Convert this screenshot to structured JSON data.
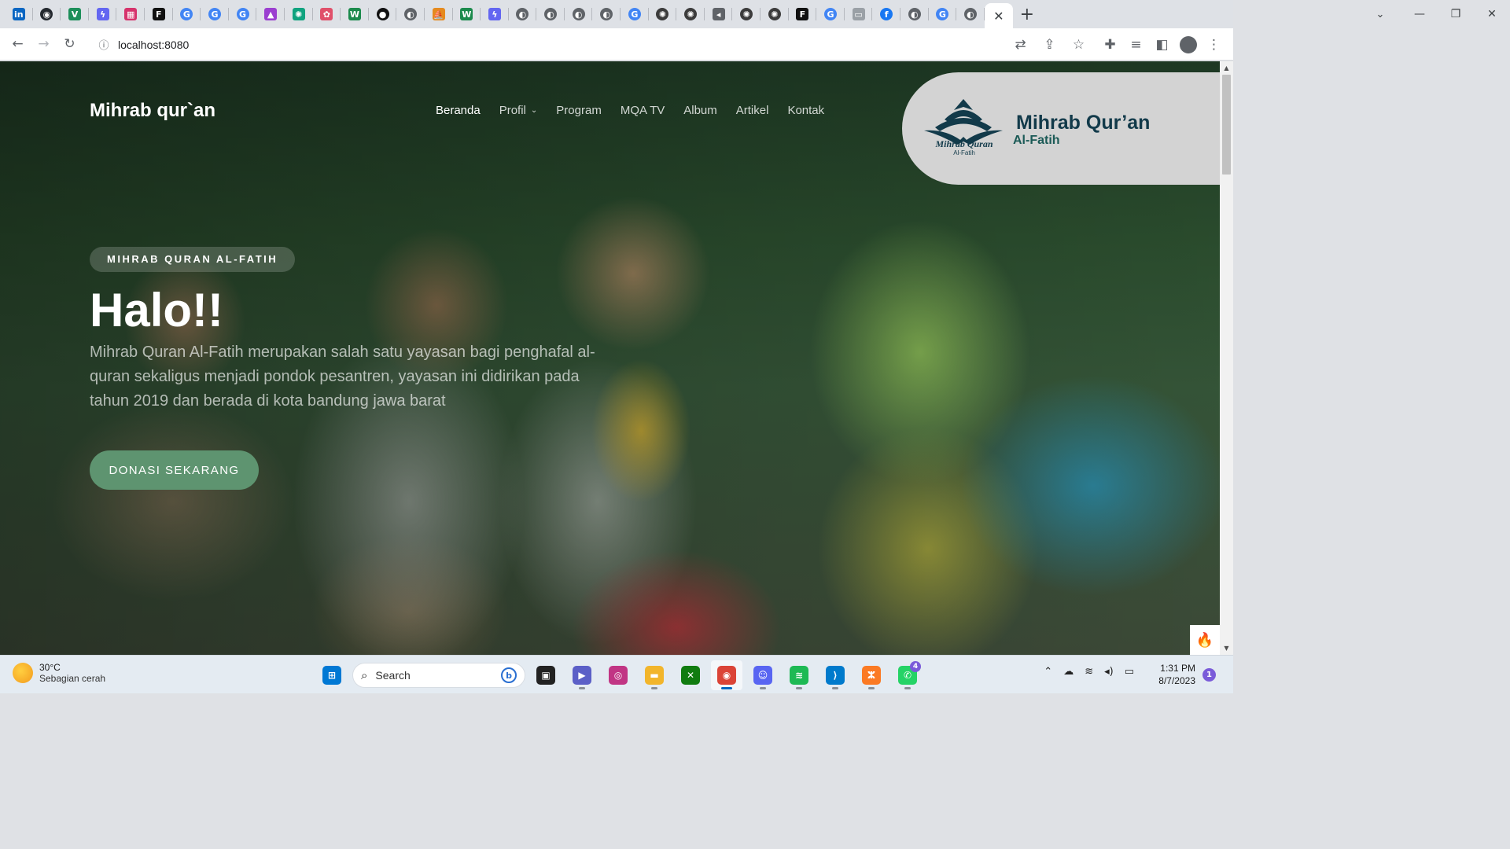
{
  "browser": {
    "tab_favicons": [
      {
        "name": "linkedin-icon",
        "glyph": "in",
        "color": "#0a66c2"
      },
      {
        "name": "github-icon",
        "glyph": "◉",
        "color": "#24292f",
        "circle": true
      },
      {
        "name": "vuejs-icon",
        "glyph": "V",
        "color": "#1d8f5a"
      },
      {
        "name": "stripe-bolt-icon",
        "glyph": "ϟ",
        "color": "#6366f1"
      },
      {
        "name": "grid-app-icon",
        "glyph": "▦",
        "color": "#d6336c"
      },
      {
        "name": "f-app-icon",
        "glyph": "F",
        "color": "#111111"
      },
      {
        "name": "google-icon",
        "glyph": "G",
        "color": "#4285f4",
        "circle": true
      },
      {
        "name": "google-icon",
        "glyph": "G",
        "color": "#4285f4",
        "circle": true
      },
      {
        "name": "google-icon",
        "glyph": "G",
        "color": "#4285f4",
        "circle": true
      },
      {
        "name": "triangle-app-icon",
        "glyph": "▲",
        "color": "#9b3fd0"
      },
      {
        "name": "chatgpt-icon",
        "glyph": "✺",
        "color": "#10a37f"
      },
      {
        "name": "brain-app-icon",
        "glyph": "✿",
        "color": "#e0506a"
      },
      {
        "name": "w-app-icon",
        "glyph": "W",
        "color": "#1b8a4c"
      },
      {
        "name": "record-app-icon",
        "glyph": "●",
        "color": "#111111",
        "circle": true
      },
      {
        "name": "globe-icon",
        "glyph": "◐",
        "color": "#5f6368",
        "circle": true
      },
      {
        "name": "pma-app-icon",
        "glyph": "⛵",
        "color": "#e58a1f"
      },
      {
        "name": "w-app-icon",
        "glyph": "W",
        "color": "#1b8a4c"
      },
      {
        "name": "stripe-bolt-icon",
        "glyph": "ϟ",
        "color": "#6366f1"
      },
      {
        "name": "globe-icon",
        "glyph": "◐",
        "color": "#5f6368",
        "circle": true
      },
      {
        "name": "globe-icon",
        "glyph": "◐",
        "color": "#5f6368",
        "circle": true
      },
      {
        "name": "globe-icon",
        "glyph": "◐",
        "color": "#5f6368",
        "circle": true
      },
      {
        "name": "globe-icon",
        "glyph": "◐",
        "color": "#5f6368",
        "circle": true
      },
      {
        "name": "google-icon",
        "glyph": "G",
        "color": "#4285f4",
        "circle": true
      },
      {
        "name": "openai-icon",
        "glyph": "✺",
        "color": "#3c3c3c",
        "circle": true
      },
      {
        "name": "openai-icon",
        "glyph": "✺",
        "color": "#3c3c3c",
        "circle": true
      },
      {
        "name": "speaker-icon",
        "glyph": "◂",
        "color": "#5f6368"
      },
      {
        "name": "openai-icon",
        "glyph": "✺",
        "color": "#3c3c3c",
        "circle": true
      },
      {
        "name": "openai-icon",
        "glyph": "✺",
        "color": "#3c3c3c",
        "circle": true
      },
      {
        "name": "f-app-icon",
        "glyph": "F",
        "color": "#111111"
      },
      {
        "name": "google-icon",
        "glyph": "G",
        "color": "#4285f4",
        "circle": true
      },
      {
        "name": "blank-page-icon",
        "glyph": "▭",
        "color": "#9aa0a6"
      },
      {
        "name": "facebook-icon",
        "glyph": "f",
        "color": "#1877f2",
        "circle": true
      },
      {
        "name": "globe-icon",
        "glyph": "◐",
        "color": "#5f6368",
        "circle": true
      },
      {
        "name": "google-icon",
        "glyph": "G",
        "color": "#4285f4",
        "circle": true
      },
      {
        "name": "globe-icon",
        "glyph": "◐",
        "color": "#5f6368",
        "circle": true
      }
    ],
    "active_tab_close_glyph": "✕",
    "new_tab_glyph": "+",
    "tab_search_glyph": "⌄",
    "window_controls": {
      "minimize": "—",
      "maximize": "❐",
      "close": "✕"
    },
    "url": "localhost:8080",
    "nav_glyphs": {
      "back": "←",
      "forward": "→",
      "reload": "↻",
      "info": "ⓘ"
    },
    "omnibox_actions": [
      {
        "name": "translate-icon",
        "glyph": "⇄"
      },
      {
        "name": "share-icon",
        "glyph": "⇪"
      },
      {
        "name": "bookmark-star-icon",
        "glyph": "☆"
      }
    ],
    "toolbar_actions": [
      {
        "name": "extensions-icon",
        "glyph": "✚"
      },
      {
        "name": "media-queue-icon",
        "glyph": "≡"
      },
      {
        "name": "side-panel-icon",
        "glyph": "◧"
      },
      {
        "name": "profile-icon",
        "glyph": ""
      },
      {
        "name": "menu-kebab-icon",
        "glyph": "⋮"
      }
    ]
  },
  "site": {
    "brand": "Mihrab qur`an",
    "nav": [
      {
        "label": "Beranda",
        "active": true
      },
      {
        "label": "Profil",
        "dropdown": true
      },
      {
        "label": "Program"
      },
      {
        "label": "MQA TV"
      },
      {
        "label": "Album"
      },
      {
        "label": "Artikel"
      },
      {
        "label": "Kontak"
      }
    ],
    "nav_caret": "⌄",
    "logo": {
      "mark_text": "Mihrab Quran",
      "mark_sub": "Al-Fatih",
      "title": "Mihrab Qur’an",
      "subtitle": "Al-Fatih"
    },
    "hero": {
      "badge": "MIHRAB QURAN AL-FATIH",
      "headline": "Halo!!",
      "lead": "Mihrab Quran Al-Fatih merupakan salah satu yayasan bagi penghafal al-quran sekaligus menjadi pondok pesantren, yayasan ini didirikan pada tahun 2019 dan berada di kota bandung jawa barat",
      "cta": "DONASI SEKARANG"
    },
    "fire_glyph": "🔥",
    "colors": {
      "accent": "#5e9470",
      "logo_navy": "#123a4a"
    }
  },
  "scrollbar": {
    "up": "▲",
    "down": "▼"
  },
  "taskbar": {
    "weather": {
      "temp": "30°C",
      "desc": "Sebagian cerah"
    },
    "search_label": "Search",
    "apps": [
      {
        "name": "windows-start-icon",
        "glyph": "⊞",
        "color": "#0078d4"
      },
      {
        "name": "search-box"
      },
      {
        "name": "task-view-icon",
        "glyph": "▣",
        "color": "#222222"
      },
      {
        "name": "meet-icon",
        "glyph": "▶",
        "color": "#5b5fc7",
        "running": true
      },
      {
        "name": "instagram-icon",
        "glyph": "◎",
        "color": "#c13584"
      },
      {
        "name": "file-explorer-icon",
        "glyph": "▬",
        "color": "#f2b52b",
        "running": true
      },
      {
        "name": "xbox-icon",
        "glyph": "✕",
        "color": "#107c10"
      },
      {
        "name": "chrome-icon",
        "glyph": "◉",
        "color": "#db4437",
        "running": true,
        "focused": true
      },
      {
        "name": "discord-icon",
        "glyph": "☺",
        "color": "#5865f2",
        "running": true
      },
      {
        "name": "spotify-icon",
        "glyph": "≋",
        "color": "#1db954",
        "running": true
      },
      {
        "name": "vscode-icon",
        "glyph": "⟩",
        "color": "#007acc",
        "running": true
      },
      {
        "name": "xampp-icon",
        "glyph": "ⵣ",
        "color": "#fb7a24",
        "running": true
      },
      {
        "name": "whatsapp-icon",
        "glyph": "✆",
        "color": "#25d366",
        "running": true,
        "badge": "4"
      }
    ],
    "tray": [
      {
        "name": "chevron-up-icon",
        "glyph": "⌃"
      },
      {
        "name": "cloud-off-icon",
        "glyph": "☁"
      },
      {
        "name": "wifi-icon",
        "glyph": "≋"
      },
      {
        "name": "volume-icon",
        "glyph": "◂)"
      },
      {
        "name": "battery-icon",
        "glyph": "▭"
      }
    ],
    "time": "1:31 PM",
    "date": "8/7/2023",
    "notification_count": "1"
  }
}
